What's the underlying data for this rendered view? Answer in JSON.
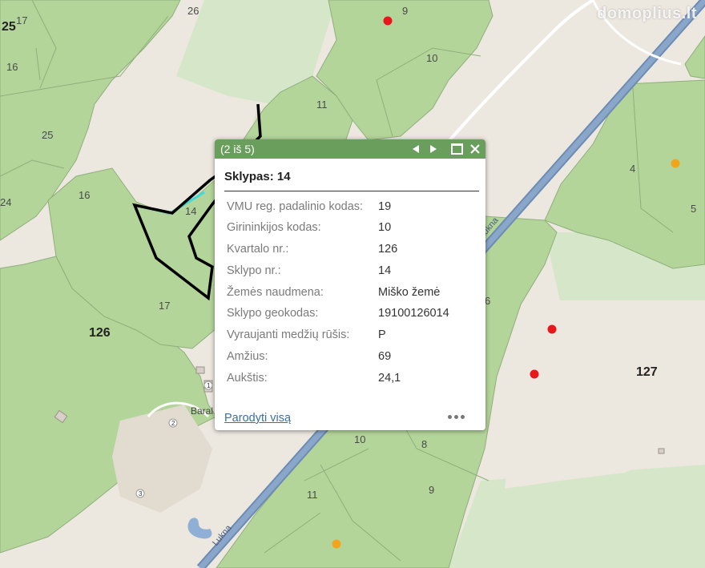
{
  "map": {
    "watermark": "domoplius.lt",
    "parcel_labels": [
      "17",
      "26",
      "25",
      "16",
      "25",
      "24",
      "16",
      "14",
      "17",
      "126",
      "9",
      "10",
      "11",
      "4",
      "5",
      "6",
      "127",
      "10",
      "8",
      "11",
      "9"
    ],
    "place_labels": [
      "Baral",
      "Lukna",
      "Lukna"
    ],
    "building_numbers": [
      "1",
      "2",
      "3"
    ],
    "colors": {
      "forest": "#b3d59a",
      "forest_edge": "#8faf7c",
      "open_land": "#ece7df",
      "light_green": "#d6e6c8",
      "road": "#8aa6c8",
      "road_edge": "#6c8bb5",
      "water": "#8fb0d4",
      "building": "#d8d0c8",
      "marker_red": "#e8171b",
      "marker_orange": "#f2a51c",
      "outline": "#000000",
      "highlight": "#40d8d8"
    }
  },
  "popup": {
    "counter": "(2 iš 5)",
    "title": "Sklypas: 14",
    "header_icons": [
      "previous-icon",
      "next-icon",
      "maximize-icon",
      "close-icon"
    ],
    "attributes": [
      {
        "label": "VMU reg. padalinio kodas:",
        "value": "19"
      },
      {
        "label": "Girininkijos kodas:",
        "value": "10"
      },
      {
        "label": "Kvartalo nr.:",
        "value": "126"
      },
      {
        "label": "Sklypo nr.:",
        "value": "14"
      },
      {
        "label": "Žemės naudmena:",
        "value": "Miško žemė"
      },
      {
        "label": "Sklypo geokodas:",
        "value": "19100126014"
      },
      {
        "label": "Vyraujanti medžių rūšis:",
        "value": "P"
      },
      {
        "label": "Amžius:",
        "value": "69"
      },
      {
        "label": "Aukštis:",
        "value": "24,1"
      }
    ],
    "show_all_link": "Parodyti visą",
    "more_icon": "ellipsis-icon"
  }
}
